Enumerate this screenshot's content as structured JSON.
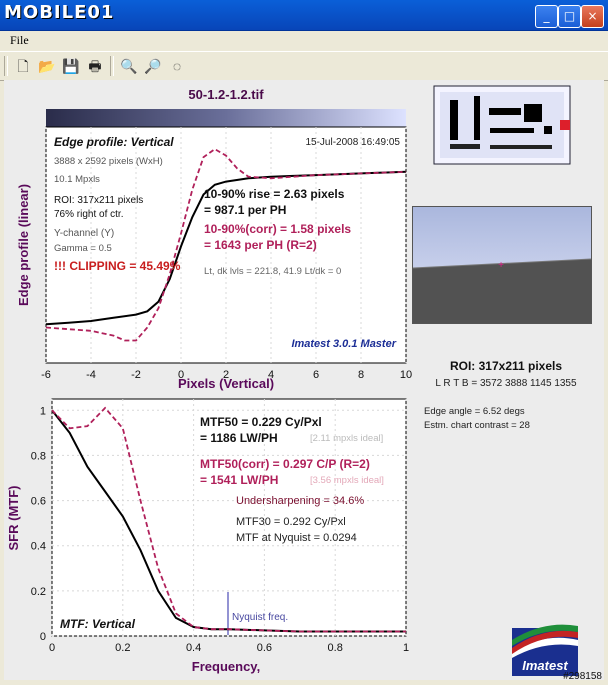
{
  "window": {
    "brand": "MOBILE01",
    "minimize": "_",
    "maximize": "□",
    "close": "×"
  },
  "menu": {
    "file": "File"
  },
  "toolbar": {
    "icons": [
      "new-icon",
      "open-icon",
      "save-icon",
      "print-icon",
      "zoom-in-icon",
      "zoom-out-icon",
      "reset-zoom-icon"
    ]
  },
  "file_name": "50-1.2-1.2.tif",
  "edge": {
    "title": "Edge profile: Vertical",
    "date": "15-Jul-2008 16:49:05",
    "size": "3888 x 2592 pixels (WxH)",
    "mpx": "10.1 Mpxls",
    "roi": "ROI:  317x211 pixels",
    "pos": "76% right of ctr.",
    "channel": "Y-channel  (Y)",
    "gamma": "Gamma = 0.5",
    "clipping": "!!! CLIPPING =  45.49%",
    "rise1": "10-90% rise = 2.63 pixels",
    "rise2": "= 987.1 per PH",
    "corr1": "10-90%(corr) = 1.58 pixels",
    "corr2": "= 1643 per PH  (R=2)",
    "levels": "Lt, dk lvls = 221.8, 41.9   Lt/dk = 0",
    "brand": "Imatest 3.0.1 Master",
    "xlabel": "Pixels (Vertical)",
    "ylabel": "Edge profile (linear)"
  },
  "mtf": {
    "title": "MTF: Vertical",
    "mtf50a": "MTF50 = 0.229 Cy/Pxl",
    "mtf50b": "= 1186 LW/PH",
    "ideal1": "[2.11 mpxls ideal]",
    "corra": "MTF50(corr) = 0.297 C/P  (R=2)",
    "corrb": "= 1541 LW/PH",
    "ideal2": "[3.56 mpxls ideal]",
    "under": "Undersharpening = 34.6%",
    "mtf30": "MTF30 = 0.292 Cy/Pxl",
    "nyq": "MTF at Nyquist = 0.0294",
    "nyqlabel": "Nyquist freq.",
    "xlabel": "Frequency,",
    "ylabel": "SFR (MTF)"
  },
  "side": {
    "roi": "ROI:  317x211 pixels",
    "lrtb": "L R  T B = 3572 3888   1145 1355",
    "angle": "Edge angle = 6.52 degs",
    "contrast": "Estm. chart contrast = 28",
    "logo": "Imatest",
    "watermark": "#298158"
  },
  "chart_data": [
    {
      "type": "line",
      "title": "Edge profile: Vertical",
      "xlabel": "Pixels (Vertical)",
      "ylabel": "Edge profile (linear)",
      "xlim": [
        -6,
        10
      ],
      "xticks": [
        -6,
        -4,
        -2,
        0,
        2,
        4,
        6,
        8,
        10
      ],
      "series": [
        {
          "x": [
            -6,
            -5,
            -4,
            -3,
            -2,
            -1.5,
            -1,
            -0.5,
            0,
            0.5,
            1,
            1.5,
            2,
            3,
            4,
            5,
            6,
            7,
            8,
            9,
            10
          ],
          "values": [
            0.02,
            0.03,
            0.04,
            0.06,
            0.08,
            0.1,
            0.16,
            0.3,
            0.5,
            0.68,
            0.82,
            0.88,
            0.9,
            0.92,
            0.93,
            0.935,
            0.94,
            0.945,
            0.95,
            0.955,
            0.96
          ]
        },
        {
          "x": [
            -6,
            -5,
            -4,
            -3,
            -2.5,
            -2,
            -1.5,
            -1,
            -0.5,
            0,
            0.5,
            1,
            1.5,
            2,
            2.5,
            3,
            4,
            5,
            6,
            7,
            8,
            9,
            10
          ],
          "values": [
            0.0,
            -0.01,
            -0.02,
            -0.05,
            -0.08,
            -0.08,
            0.0,
            0.12,
            0.33,
            0.58,
            0.85,
            1.05,
            1.1,
            1.06,
            0.98,
            0.93,
            0.92,
            0.93,
            0.94,
            0.945,
            0.95,
            0.955,
            0.96
          ]
        }
      ]
    },
    {
      "type": "line",
      "title": "MTF: Vertical",
      "xlabel": "Frequency,",
      "ylabel": "SFR (MTF)",
      "xlim": [
        0,
        1
      ],
      "ylim": [
        0,
        1.05
      ],
      "xticks": [
        0,
        0.2,
        0.4,
        0.6,
        0.8,
        1
      ],
      "yticks": [
        0,
        0.2,
        0.4,
        0.6,
        0.8,
        1
      ],
      "series": [
        {
          "x": [
            0,
            0.05,
            0.1,
            0.15,
            0.2,
            0.25,
            0.3,
            0.35,
            0.4,
            0.45,
            0.5,
            0.6,
            0.7,
            0.8,
            0.9,
            1
          ],
          "values": [
            1,
            0.9,
            0.75,
            0.64,
            0.53,
            0.38,
            0.2,
            0.08,
            0.04,
            0.03,
            0.03,
            0.025,
            0.02,
            0.02,
            0.02,
            0.02
          ]
        },
        {
          "x": [
            0,
            0.05,
            0.1,
            0.15,
            0.2,
            0.25,
            0.3,
            0.35,
            0.4,
            0.45,
            0.5,
            0.6,
            0.7,
            0.8,
            0.9,
            1
          ],
          "values": [
            1,
            0.92,
            0.93,
            1.01,
            0.92,
            0.6,
            0.3,
            0.1,
            0.04,
            0.03,
            0.03,
            0.025,
            0.02,
            0.02,
            0.02,
            0.02
          ]
        }
      ]
    }
  ]
}
